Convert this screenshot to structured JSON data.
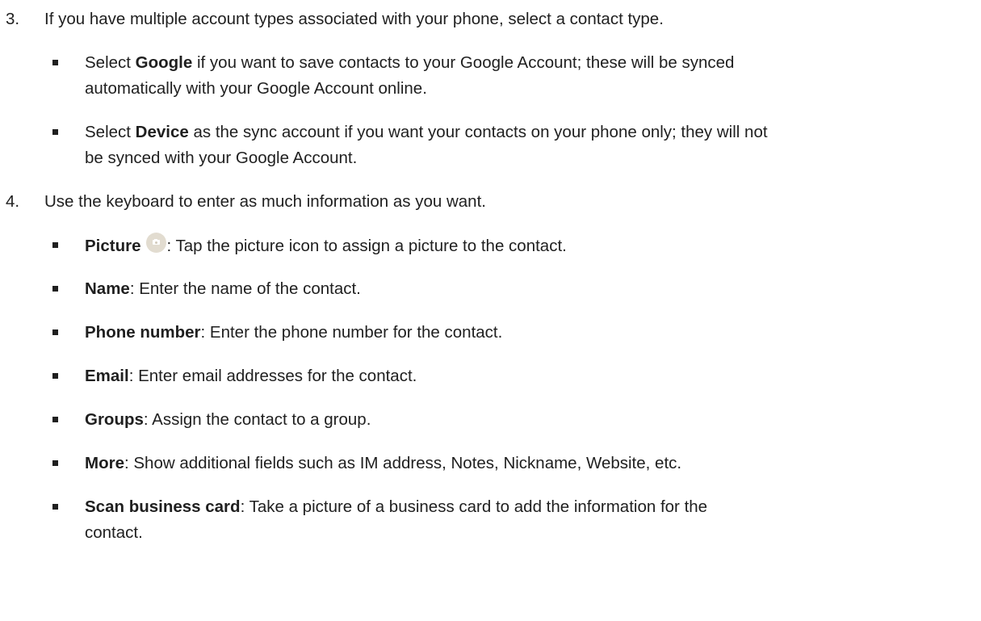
{
  "steps": [
    {
      "number": "3.",
      "text": "If you have multiple account types associated with your phone, select a contact type.",
      "bullets": [
        {
          "pre": "Select ",
          "bold": "Google",
          "post": " if you want to save contacts to your Google Account; these will be synced",
          "post2": "automatically with your Google Account online."
        },
        {
          "pre": "Select ",
          "bold": "Device",
          "post": " as the sync account if you want your contacts on your phone only; they will not",
          "post2": "be synced with your Google Account."
        }
      ]
    },
    {
      "number": "4.",
      "text": "Use the keyboard to enter as much information as you want.",
      "bullets": [
        {
          "bold": "Picture",
          "post": ": Tap the picture icon to assign a picture to the contact.",
          "icon": "camera-icon"
        },
        {
          "bold": "Name",
          "post": ": Enter the name of the contact."
        },
        {
          "bold": "Phone number",
          "post": ": Enter the phone number for the contact."
        },
        {
          "bold": "Email",
          "post": ": Enter email addresses for the contact."
        },
        {
          "bold": "Groups",
          "post": ": Assign the contact to a group."
        },
        {
          "bold": "More",
          "post": ": Show additional fields such as IM address, Notes, Nickname, Website, etc."
        },
        {
          "bold": "Scan business card",
          "post": ": Take a picture of a business card to add the information for the",
          "post2": "contact."
        }
      ]
    }
  ],
  "colors": {
    "text": "#1f1f1f",
    "icon_bg": "#e2dcd0"
  }
}
